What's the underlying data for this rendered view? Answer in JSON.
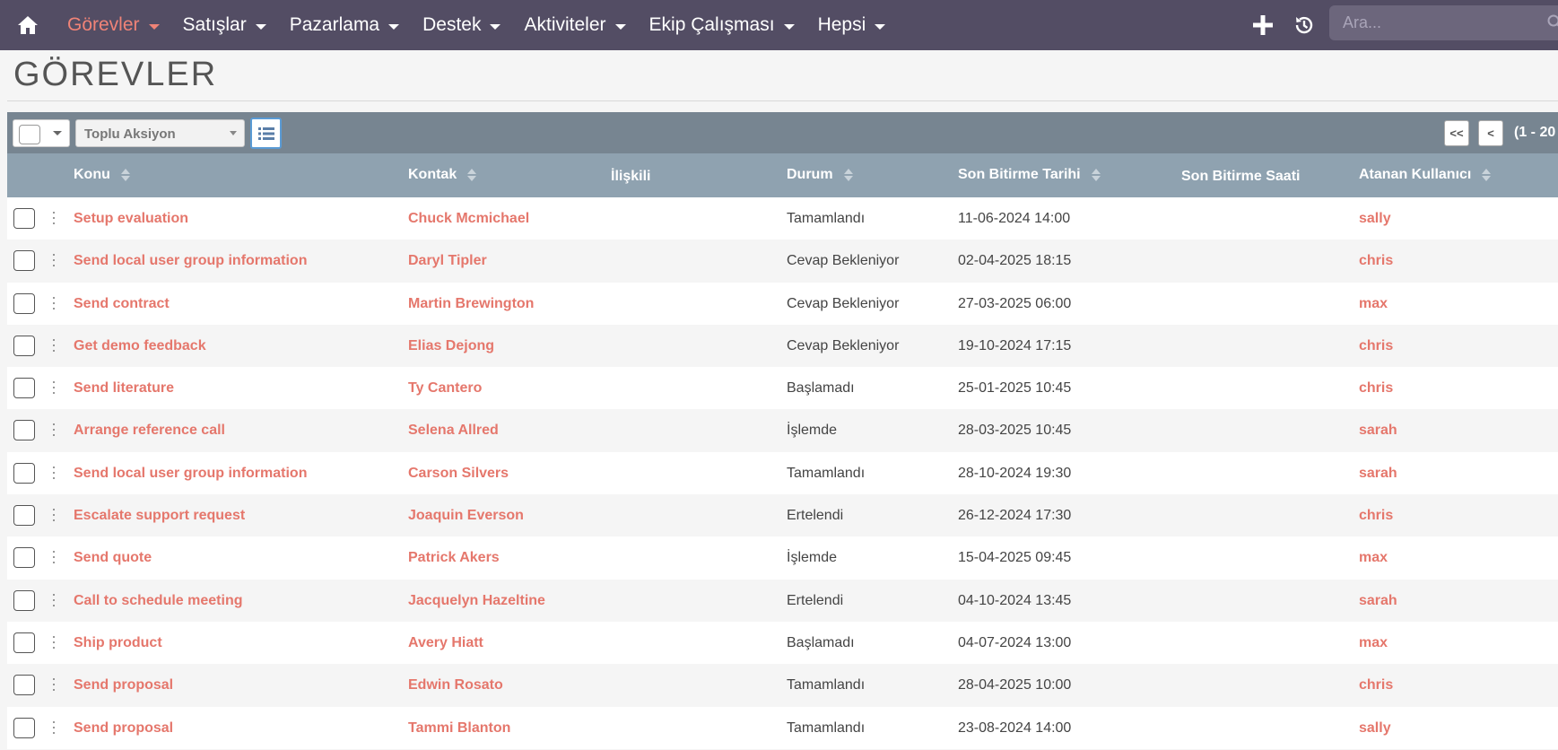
{
  "nav": {
    "items": [
      {
        "label": "Görevler",
        "active": true
      },
      {
        "label": "Satışlar",
        "active": false
      },
      {
        "label": "Pazarlama",
        "active": false
      },
      {
        "label": "Destek",
        "active": false
      },
      {
        "label": "Aktiviteler",
        "active": false
      },
      {
        "label": "Ekip Çalışması",
        "active": false
      },
      {
        "label": "Hepsi",
        "active": false
      }
    ],
    "search_placeholder": "Ara..."
  },
  "page": {
    "title": "GÖREVLER"
  },
  "toolbar": {
    "bulk_action": "Toplu Aksiyon",
    "first_page": "<<",
    "prev_page": "<",
    "pagination": "(1 - 20"
  },
  "table": {
    "columns": {
      "subject": "Konu",
      "contact": "Kontak",
      "related": "İlişkili",
      "status": "Durum",
      "due_date": "Son Bitirme Tarihi",
      "due_time": "Son Bitirme Saati",
      "assigned": "Atanan Kullanıcı"
    },
    "rows": [
      {
        "subject": "Setup evaluation",
        "contact": "Chuck Mcmichael",
        "status": "Tamamlandı",
        "due": "11-06-2024 14:00",
        "user": "sally"
      },
      {
        "subject": "Send local user group information",
        "contact": "Daryl Tipler",
        "status": "Cevap Bekleniyor",
        "due": "02-04-2025 18:15",
        "user": "chris"
      },
      {
        "subject": "Send contract",
        "contact": "Martin Brewington",
        "status": "Cevap Bekleniyor",
        "due": "27-03-2025 06:00",
        "user": "max"
      },
      {
        "subject": "Get demo feedback",
        "contact": "Elias Dejong",
        "status": "Cevap Bekleniyor",
        "due": "19-10-2024 17:15",
        "user": "chris"
      },
      {
        "subject": "Send literature",
        "contact": "Ty Cantero",
        "status": "Başlamadı",
        "due": "25-01-2025 10:45",
        "user": "chris"
      },
      {
        "subject": "Arrange reference call",
        "contact": "Selena Allred",
        "status": "İşlemde",
        "due": "28-03-2025 10:45",
        "user": "sarah"
      },
      {
        "subject": "Send local user group information",
        "contact": "Carson Silvers",
        "status": "Tamamlandı",
        "due": "28-10-2024 19:30",
        "user": "sarah"
      },
      {
        "subject": "Escalate support request",
        "contact": "Joaquin Everson",
        "status": "Ertelendi",
        "due": "26-12-2024 17:30",
        "user": "chris"
      },
      {
        "subject": "Send quote",
        "contact": "Patrick Akers",
        "status": "İşlemde",
        "due": "15-04-2025 09:45",
        "user": "max"
      },
      {
        "subject": "Call to schedule meeting",
        "contact": "Jacquelyn Hazeltine",
        "status": "Ertelendi",
        "due": "04-10-2024 13:45",
        "user": "sarah"
      },
      {
        "subject": "Ship product",
        "contact": "Avery Hiatt",
        "status": "Başlamadı",
        "due": "04-07-2024 13:00",
        "user": "max"
      },
      {
        "subject": "Send proposal",
        "contact": "Edwin Rosato",
        "status": "Tamamlandı",
        "due": "28-04-2025 10:00",
        "user": "chris"
      },
      {
        "subject": "Send proposal",
        "contact": "Tammi Blanton",
        "status": "Tamamlandı",
        "due": "23-08-2024 14:00",
        "user": "sally"
      }
    ]
  },
  "colors": {
    "nav_bg": "#534d64",
    "accent": "#f08377",
    "link": "#e5776c",
    "toolbar_bg": "#778591",
    "header_bg": "#8fa2b0"
  },
  "icons": {
    "home": "home-icon",
    "create": "plus-icon",
    "recent": "history-icon",
    "search": "search-icon",
    "list": "list-view-icon"
  }
}
